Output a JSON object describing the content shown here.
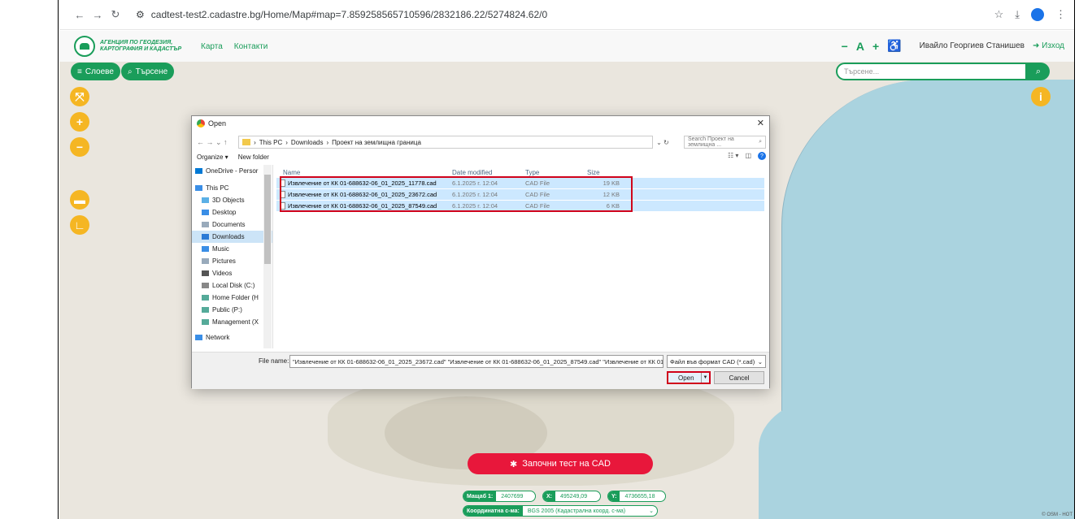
{
  "browser": {
    "url": "cadtest-test2.cadastre.bg/Home/Map#map=7.859258565710596/2832186.22/5274824.62/0"
  },
  "header": {
    "agency_name": "АГЕНЦИЯ ПО ГЕОДЕЗИЯ, КАРТОГРАФИЯ И КАДАСТЪР",
    "nav": [
      "Карта",
      "Контакти"
    ],
    "zoom_minus": "−",
    "zoom_a": "A",
    "zoom_plus": "+",
    "accessibility_icon": "♿",
    "user_name": "Ивайло Георгиев Станишев",
    "logout_label": "Изход"
  },
  "map_controls": {
    "layers_label": "Слоеве",
    "search_label": "Търсене",
    "search_placeholder": "Търсене..."
  },
  "cad_test_label": "Започни тест на CAD",
  "status": {
    "scale_label": "Мащаб 1:",
    "scale_value": "2407699",
    "x_label": "X:",
    "x_value": "495249,09",
    "y_label": "Y:",
    "y_value": "4736655,18",
    "crs_label": "Координатна с-ма:",
    "crs_value": "BGS 2005 (Кадастрална коорд. с-ма)"
  },
  "attribution": "© OSM - HOT",
  "dialog": {
    "title": "Open",
    "path": [
      "This PC",
      "Downloads",
      "Проект на землищна граница"
    ],
    "search_placeholder": "Search Проект на землищна ...",
    "organize_label": "Organize ▾",
    "new_folder_label": "New folder",
    "nav_items": [
      {
        "label": "OneDrive - Persor",
        "icon": "cloud-icon",
        "color": "#0078d4"
      },
      {
        "label": "This PC",
        "icon": "pc-icon",
        "color": "#3a8ee6"
      },
      {
        "label": "3D Objects",
        "icon": "3d-objects-icon",
        "color": "#5bb0e6"
      },
      {
        "label": "Desktop",
        "icon": "desktop-icon",
        "color": "#3a8ee6"
      },
      {
        "label": "Documents",
        "icon": "documents-icon",
        "color": "#9ab"
      },
      {
        "label": "Downloads",
        "icon": "downloads-icon",
        "color": "#2a7ad6"
      },
      {
        "label": "Music",
        "icon": "music-icon",
        "color": "#3a8ee6"
      },
      {
        "label": "Pictures",
        "icon": "pictures-icon",
        "color": "#9ab"
      },
      {
        "label": "Videos",
        "icon": "videos-icon",
        "color": "#555"
      },
      {
        "label": "Local Disk (C:)",
        "icon": "disk-icon",
        "color": "#888"
      },
      {
        "label": "Home Folder (H",
        "icon": "network-drive-icon",
        "color": "#5a9"
      },
      {
        "label": "Public (P:)",
        "icon": "network-drive-icon",
        "color": "#5a9"
      },
      {
        "label": "Management (X",
        "icon": "network-drive-icon",
        "color": "#5a9"
      },
      {
        "label": "Network",
        "icon": "network-icon",
        "color": "#3a8ee6"
      }
    ],
    "columns": [
      "Name",
      "Date modified",
      "Type",
      "Size"
    ],
    "files": [
      {
        "name": "Извлечение от КК 01-688632-06_01_2025_11778.cad",
        "date": "6.1.2025 г. 12:04",
        "type": "CAD File",
        "size": "19 KB"
      },
      {
        "name": "Извлечение от КК 01-688632-06_01_2025_23672.cad",
        "date": "6.1.2025 г. 12:04",
        "type": "CAD File",
        "size": "12 KB"
      },
      {
        "name": "Извлечение от КК 01-688632-06_01_2025_87549.cad",
        "date": "6.1.2025 г. 12:04",
        "type": "CAD File",
        "size": "6 KB"
      }
    ],
    "file_name_label": "File name:",
    "file_name_value": "\"Извлечение от КК 01-688632-06_01_2025_23672.cad\" \"Извлечение от КК 01-688632-06_01_2025_87549.cad\" \"Извлечение от КК 01-6",
    "file_type_value": "Файл във формат CAD (*.cad)",
    "open_label": "Open",
    "cancel_label": "Cancel"
  }
}
